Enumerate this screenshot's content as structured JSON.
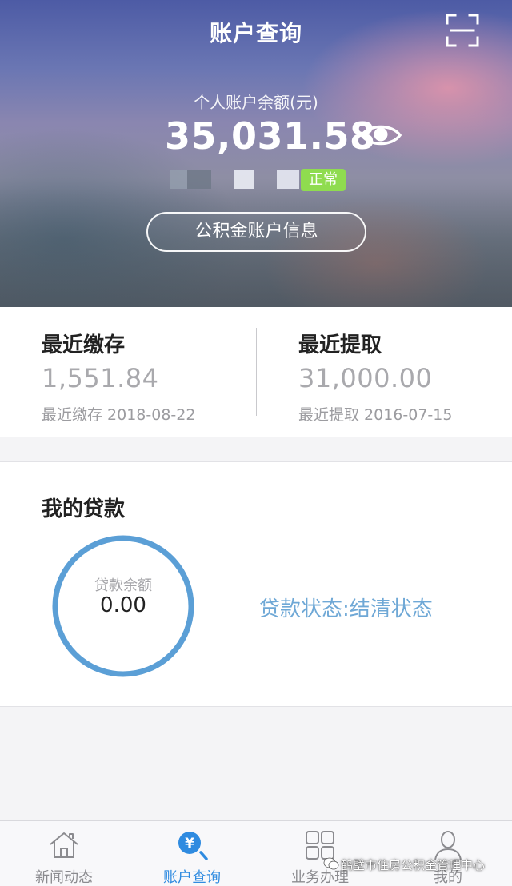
{
  "header": {
    "title": "账户查询",
    "balance_label": "个人账户余额(元)",
    "balance_value": "35,031.58",
    "status_badge": "正常",
    "info_button_label": "公积金账户信息"
  },
  "recent": {
    "deposit": {
      "title": "最近缴存",
      "amount": "1,551.84",
      "date_text": "最近缴存 2018-08-22"
    },
    "withdrawal": {
      "title": "最近提取",
      "amount": "31,000.00",
      "date_text": "最近提取 2016-07-15"
    }
  },
  "loan": {
    "title": "我的贷款",
    "balance_label": "贷款余额",
    "balance_value": "0.00",
    "status_text": "贷款状态:结清状态"
  },
  "tabbar": {
    "tabs": [
      {
        "label": "新闻动态",
        "icon": "home-icon",
        "active": false
      },
      {
        "label": "账户查询",
        "icon": "yuan-search-icon",
        "active": true
      },
      {
        "label": "业务办理",
        "icon": "grid-icon",
        "active": false
      },
      {
        "label": "我的",
        "icon": "user-icon",
        "active": false
      }
    ]
  },
  "watermark": "鹤壁市住房公积金管理中心",
  "colors": {
    "accent": "#2f8be0",
    "loan_ring": "#5b9fd6",
    "status_badge": "#8fdc4f",
    "loan_status": "#6fa8d6"
  }
}
